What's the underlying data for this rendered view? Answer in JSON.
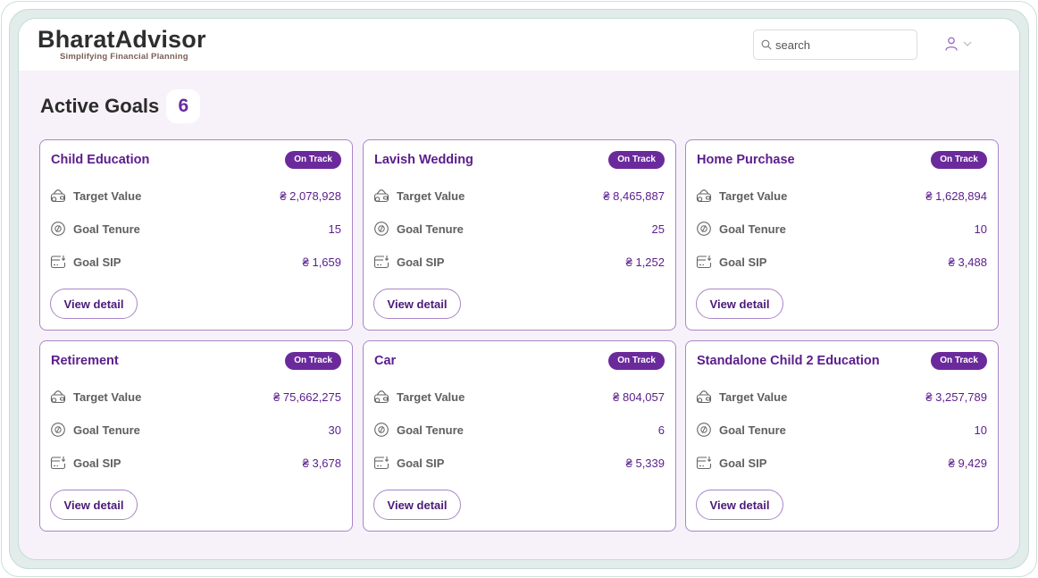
{
  "brand": {
    "title": "BharatAdvisor",
    "tagline": "Simplifying Financial Planning"
  },
  "header": {
    "search_placeholder": "search",
    "search_value": "",
    "search_icon": "search-icon",
    "user_icon": "user-icon",
    "dropdown_icon": "chevron-down-icon"
  },
  "page": {
    "title": "Active Goals",
    "count": "6"
  },
  "colors": {
    "accent": "#6b2a9c",
    "title": "#5a1d8c",
    "card_border": "#a985c9",
    "background": "#f7f2f9",
    "frame": "#e2ecea"
  },
  "labels": {
    "target_value": "Target Value",
    "goal_tenure": "Goal Tenure",
    "goal_sip": "Goal SIP",
    "view_detail": "View detail"
  },
  "icons": {
    "target_value": "wallet-icon",
    "goal_tenure": "coin-icon",
    "goal_sip": "card-add-icon"
  },
  "goals": [
    {
      "name": "Child Education",
      "status": "On Track",
      "target_value": "₴ 2,078,928",
      "tenure": "15",
      "sip": "₴ 1,659"
    },
    {
      "name": "Lavish Wedding",
      "status": "On Track",
      "target_value": "₴ 8,465,887",
      "tenure": "25",
      "sip": "₴ 1,252"
    },
    {
      "name": "Home Purchase",
      "status": "On Track",
      "target_value": "₴ 1,628,894",
      "tenure": "10",
      "sip": "₴ 3,488"
    },
    {
      "name": "Retirement",
      "status": "On Track",
      "target_value": "₴ 75,662,275",
      "tenure": "30",
      "sip": "₴ 3,678"
    },
    {
      "name": "Car",
      "status": "On Track",
      "target_value": "₴ 804,057",
      "tenure": "6",
      "sip": "₴ 5,339"
    },
    {
      "name": "Standalone Child 2 Education",
      "status": "On Track",
      "target_value": "₴ 3,257,789",
      "tenure": "10",
      "sip": "₴ 9,429"
    }
  ]
}
